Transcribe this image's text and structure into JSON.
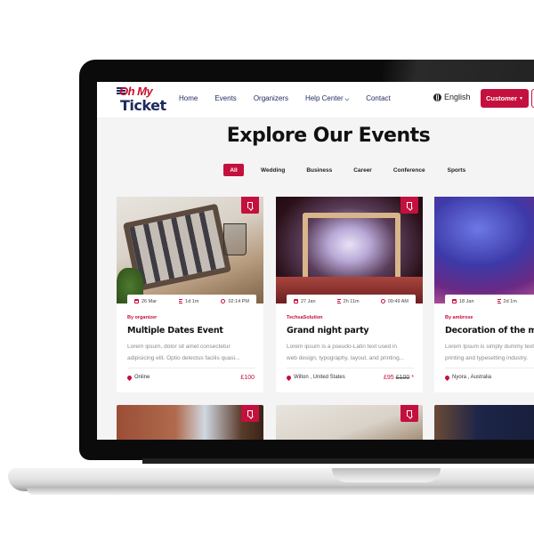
{
  "header": {
    "logo": {
      "top": "Oh My",
      "bottom": "Ticket"
    },
    "nav": [
      {
        "label": "Home"
      },
      {
        "label": "Events"
      },
      {
        "label": "Organizers"
      },
      {
        "label": "Help Center",
        "has_dropdown": true
      },
      {
        "label": "Contact"
      }
    ],
    "language": "English",
    "customer_button": "Customer"
  },
  "main": {
    "title": "Explore Our Events",
    "filters": [
      {
        "label": "All",
        "active": true
      },
      {
        "label": "Wedding"
      },
      {
        "label": "Business"
      },
      {
        "label": "Career"
      },
      {
        "label": "Conference"
      },
      {
        "label": "Sports"
      }
    ],
    "events": [
      {
        "date": "26 Mar",
        "duration": "1d 1m",
        "time": "02:14 PM",
        "organizer": "By  organizer",
        "title": "Multiple Dates Event",
        "description_line1": "Lorem ipsum, dolor sit amet consectetur",
        "description_line2": "adipisicing elit. Optio delectus facilis quasi...",
        "location": "Online",
        "price": "£100",
        "old_price": ""
      },
      {
        "date": "27 Jan",
        "duration": "2h 11m",
        "time": "09:49 AM",
        "organizer": "TechsaSolution",
        "title": "Grand night party",
        "description_line1": "Lorem ipsum is a pseudo-Latin text used in",
        "description_line2": "web design, typography, layout, and printing...",
        "location": "Wilton , United States",
        "price": "£95",
        "old_price": "£100",
        "price_note": "*"
      },
      {
        "date": "18 Jan",
        "duration": "2d 1m",
        "time": "",
        "organizer": "By  ambrose",
        "title": "Decoration of the marriage",
        "description_line1": "Lorem Ipsum is simply dummy text of the",
        "description_line2": "printing and typesetting industry.",
        "location": "Nyora , Australia",
        "price": "",
        "old_price": ""
      }
    ]
  },
  "colors": {
    "accent": "#c4103d",
    "navy": "#1d2a5e",
    "page_bg": "#f4f4f4"
  }
}
